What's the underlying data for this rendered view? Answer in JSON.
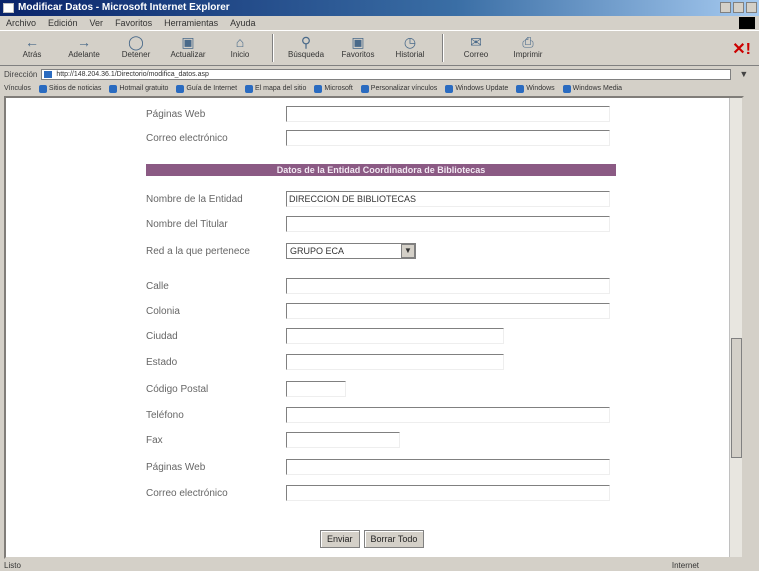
{
  "window": {
    "title": "Modificar Datos - Microsoft Internet Explorer"
  },
  "menu": [
    "Archivo",
    "Edición",
    "Ver",
    "Favoritos",
    "Herramientas",
    "Ayuda"
  ],
  "toolbar": [
    {
      "label": "Atrás",
      "icon": "back-arrow-icon"
    },
    {
      "label": "Adelante",
      "icon": "forward-arrow-icon"
    },
    {
      "label": "Detener",
      "icon": "stop-icon"
    },
    {
      "label": "Actualizar",
      "icon": "refresh-icon"
    },
    {
      "label": "Inicio",
      "icon": "home-icon"
    },
    {
      "label": "Búsqueda",
      "icon": "search-icon"
    },
    {
      "label": "Favoritos",
      "icon": "favorites-icon"
    },
    {
      "label": "Historial",
      "icon": "history-icon"
    },
    {
      "label": "Correo",
      "icon": "mail-icon"
    },
    {
      "label": "Imprimir",
      "icon": "print-icon"
    }
  ],
  "address": {
    "label": "Dirección",
    "url": "http://148.204.36.1/Directorio/modifica_datos.asp"
  },
  "links": [
    "Vínculos",
    "Sitios de noticias",
    "Hotmail gratuito",
    "Guía de Internet",
    "El mapa del sitio",
    "Microsoft",
    "Personalizar vínculos",
    "Windows Update",
    "Windows",
    "Windows Media"
  ],
  "form": {
    "section_title": "Datos de la Entidad Coordinadora de Bibliotecas",
    "top_fields": [
      {
        "label": "Páginas Web",
        "value": ""
      },
      {
        "label": "Correo electrónico",
        "value": ""
      }
    ],
    "fields": [
      {
        "label": "Nombre de la Entidad",
        "value": "DIRECCION DE BIBLIOTECAS"
      },
      {
        "label": "Nombre del Titular",
        "value": ""
      },
      {
        "label": "Red a la que pertenece",
        "value": "GRUPO ECA"
      },
      {
        "label": "Calle",
        "value": ""
      },
      {
        "label": "Colonia",
        "value": ""
      },
      {
        "label": "Ciudad",
        "value": ""
      },
      {
        "label": "Estado",
        "value": ""
      },
      {
        "label": "Código Postal",
        "value": ""
      },
      {
        "label": "Teléfono",
        "value": ""
      },
      {
        "label": "Fax",
        "value": ""
      },
      {
        "label": "Páginas Web",
        "value": ""
      },
      {
        "label": "Correo electrónico",
        "value": ""
      }
    ],
    "submit_label": "Enviar",
    "reset_label": "Borrar Todo"
  },
  "status": {
    "text": "Listo",
    "zone": "Internet"
  }
}
